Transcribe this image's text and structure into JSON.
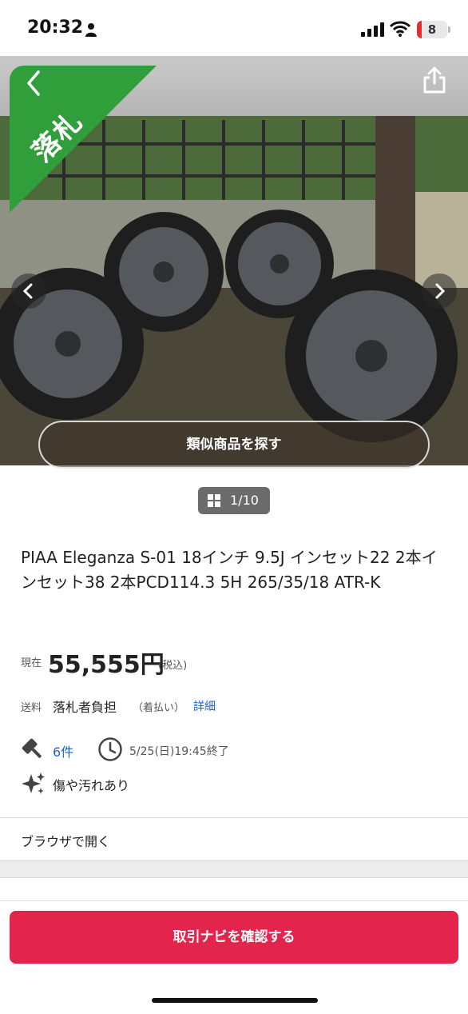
{
  "status_bar": {
    "time": "20:32",
    "battery": "8"
  },
  "badge": {
    "label": "落札"
  },
  "hero": {
    "similar_label": "類似商品を探す"
  },
  "image_counter": {
    "text": "1/10"
  },
  "item": {
    "title": "PIAA Eleganza S-01 18インチ 9.5J インセット22 2本インセット38 2本PCD114.3 5H 265/35/18 ATR-K",
    "price_label": "現在",
    "price": "55,555円",
    "tax": "(税込)",
    "shipping_label": "送料",
    "shipping_value": "落札者負担",
    "shipping_note": "（着払い）",
    "shipping_link": "詳細",
    "bids": "6件",
    "end_time": "5/25(日)19:45終了",
    "condition": "傷や汚れあり"
  },
  "links": {
    "browser": "ブラウザで開く"
  },
  "cta": {
    "label": "取引ナビを確認する"
  },
  "icons": [
    "person-icon",
    "signal-icon",
    "wifi-icon",
    "back-chevron-icon",
    "share-icon",
    "chevron-left-icon",
    "chevron-right-icon",
    "grid-icon",
    "gavel-icon",
    "clock-icon",
    "sparkle-icon"
  ],
  "colors": {
    "badge_green": "#2f9e3b",
    "link_blue": "#1d62c9",
    "cta_red": "#e3244d"
  }
}
